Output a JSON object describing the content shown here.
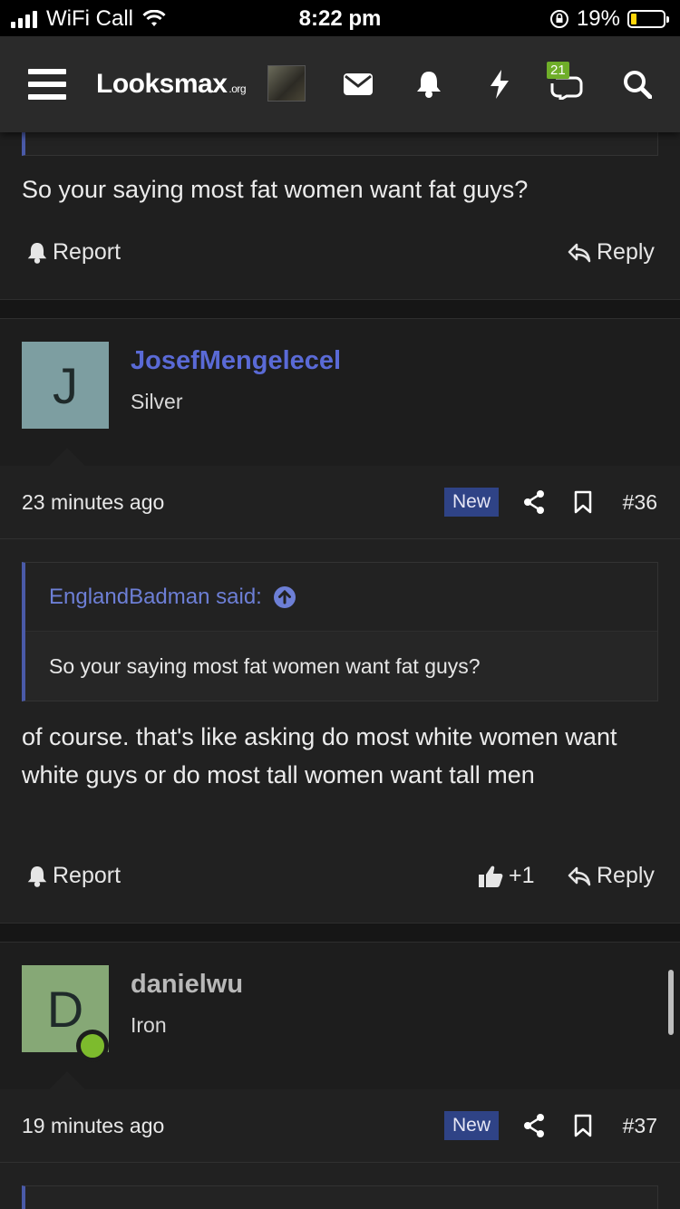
{
  "status_bar": {
    "carrier": "WiFi Call",
    "time": "8:22 pm",
    "battery": "19%"
  },
  "nav": {
    "logo": "Looksmax",
    "logo_suffix": ".org",
    "alerts_count": "21"
  },
  "posts": [
    {
      "text": "So your saying most fat women want fat guys?",
      "report_label": "Report",
      "reply_label": "Reply"
    },
    {
      "username": "JosefMengelecel",
      "avatar_letter": "J",
      "avatar_color": "#7d9ea1",
      "username_color": "#5a6ad6",
      "rank": "Silver",
      "time": "23 minutes ago",
      "new_label": "New",
      "post_number": "#36",
      "quote_author": "EnglandBadman said:",
      "quote_text": "So your saying most fat women want fat guys?",
      "text": "of course. that's like asking do most white women want white guys or do most tall women want tall men",
      "report_label": "Report",
      "like_count": "+1",
      "reply_label": "Reply"
    },
    {
      "username": "danielwu",
      "avatar_letter": "D",
      "avatar_color": "#86a876",
      "username_color": "#b8b8b8",
      "rank": "Iron",
      "time": "19 minutes ago",
      "new_label": "New",
      "post_number": "#37"
    }
  ]
}
